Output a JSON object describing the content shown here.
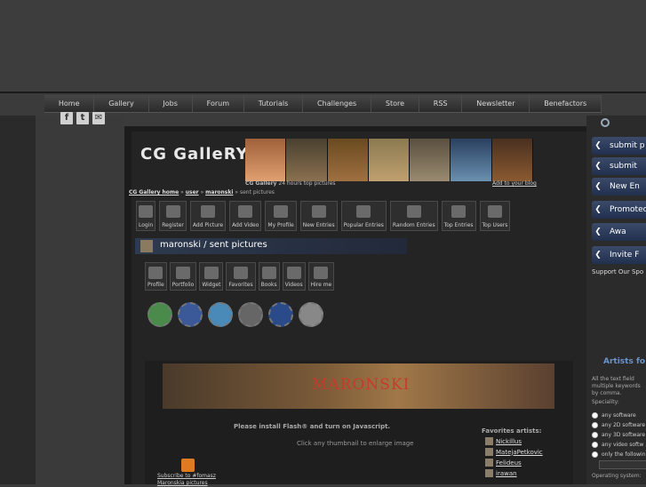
{
  "nav": {
    "items": [
      "Home",
      "Gallery",
      "Jobs",
      "Forum",
      "Tutorials",
      "Challenges",
      "Store",
      "RSS",
      "Newsletter",
      "Benefactors"
    ]
  },
  "social_top": [
    "facebook-icon",
    "twitter-icon",
    "email-icon"
  ],
  "header": {
    "logo": "CG GalleRY",
    "subtitle": "24 hours top pictures",
    "subtitle_prefix": "CG Gallery",
    "add_blog": "Add to your blog"
  },
  "breadcrumb": {
    "home": "CG Gallery home",
    "sep": "»",
    "user": "user",
    "name": "maronski",
    "current": "sent pictures"
  },
  "toolbar1": [
    "Login",
    "Register",
    "Add Picture",
    "Add Video",
    "My Profile",
    "New Entries",
    "Popular Entries",
    "Random Entries",
    "Top Entries",
    "Top Users"
  ],
  "page_title": "maronski / sent pictures",
  "toolbar2": [
    "Profile",
    "Portfolio",
    "Widget",
    "Favorites",
    "Books",
    "Videos",
    "Hire me"
  ],
  "social_icons": [
    "stumbleupon-icon",
    "facebook-icon",
    "twitter-bird-icon",
    "myspace-icon",
    "delicious-icon",
    "email-icon"
  ],
  "banner_text": "MARONSKI",
  "flash_msg": "Please install Flash® and turn on Javascript.",
  "click_msg": "Click any thumbnail to enlarge image",
  "subscribe": {
    "line1": "Subscribe to #fomasz",
    "line2": "Maronskia pictures"
  },
  "favorites": {
    "title": "Favorites artists:",
    "items": [
      "Nickillus",
      "MatejaPetkovic",
      "Felideus",
      "irawan"
    ]
  },
  "sidebar": {
    "buttons": [
      "submit p",
      "submit",
      "New En",
      "Promotec",
      "Awa",
      "Invite F"
    ],
    "support": "Support Our Spo",
    "artists_title": "Artists fo",
    "desc_lines": [
      "All the text field",
      "multiple keywords",
      "by comma."
    ],
    "speciality_label": "Speciality:",
    "radios": [
      "any software",
      "any 2D software",
      "any 3D software",
      "any video softw",
      "only the followin"
    ],
    "os_label": "Operating system:"
  },
  "colors": {
    "accent": "#6b94c8",
    "button": "#2d3d5e",
    "banner_text": "#c83a2a"
  }
}
